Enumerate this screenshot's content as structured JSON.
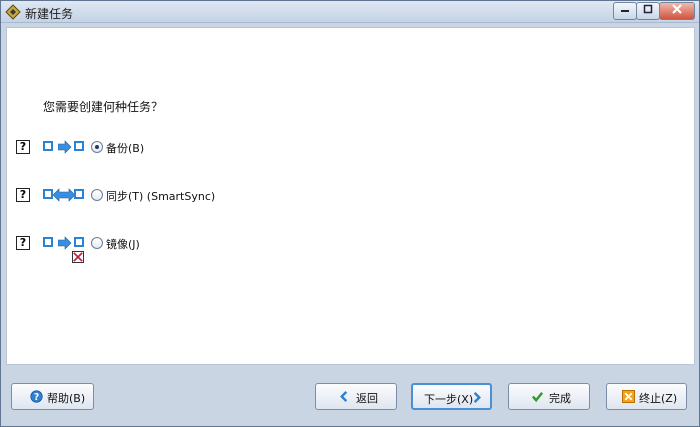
{
  "window": {
    "title": "新建任务"
  },
  "content": {
    "question": "您需要创建何种任务？"
  },
  "options": [
    {
      "label": "备份(B)",
      "selected": true,
      "icon": "backup-arrow"
    },
    {
      "label": "同步(T) (SmartSync)",
      "selected": false,
      "icon": "sync-double-arrow"
    },
    {
      "label": "镜像(J)",
      "selected": false,
      "icon": "mirror-arrow"
    }
  ],
  "help_glyph": "?",
  "buttons": {
    "help": "帮助(B)",
    "back": "返回",
    "next": "下一步(X)",
    "finish": "完成",
    "abort": "终止(Z)"
  },
  "colors": {
    "accent": "#2b83d6",
    "title_bar": "#c4d3e6",
    "content_bg": "#ffffff"
  }
}
